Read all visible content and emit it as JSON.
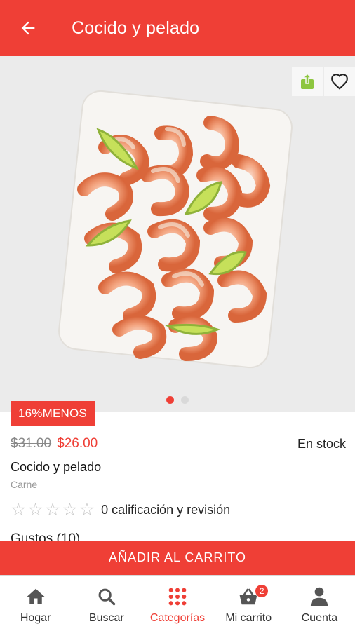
{
  "header": {
    "title": "Cocido y pelado"
  },
  "gallery": {
    "page_count": 2,
    "active_index": 0
  },
  "product": {
    "discount_badge": "16%MENOS",
    "old_price": "$31.00",
    "new_price": "$26.00",
    "stock": "En stock",
    "name": "Cocido y pelado",
    "category": "Carne",
    "rating": {
      "stars_filled": 0,
      "stars_total": 5,
      "text": "0 calificación y revisión"
    },
    "section_peek": "Gustos (10)"
  },
  "cart_button": {
    "label": "AÑADIR AL CARRITO"
  },
  "bottom_nav": {
    "items": [
      {
        "label": "Hogar",
        "icon": "home-icon"
      },
      {
        "label": "Buscar",
        "icon": "search-icon"
      },
      {
        "label": "Categorías",
        "icon": "grid-icon",
        "active": true
      },
      {
        "label": "Mi carrito",
        "icon": "basket-icon",
        "badge": "2"
      },
      {
        "label": "Cuenta",
        "icon": "person-icon"
      }
    ]
  },
  "colors": {
    "primary": "#ef3f36",
    "share_icon": "#8dc63f",
    "hero_bg": "#ebebeb"
  }
}
